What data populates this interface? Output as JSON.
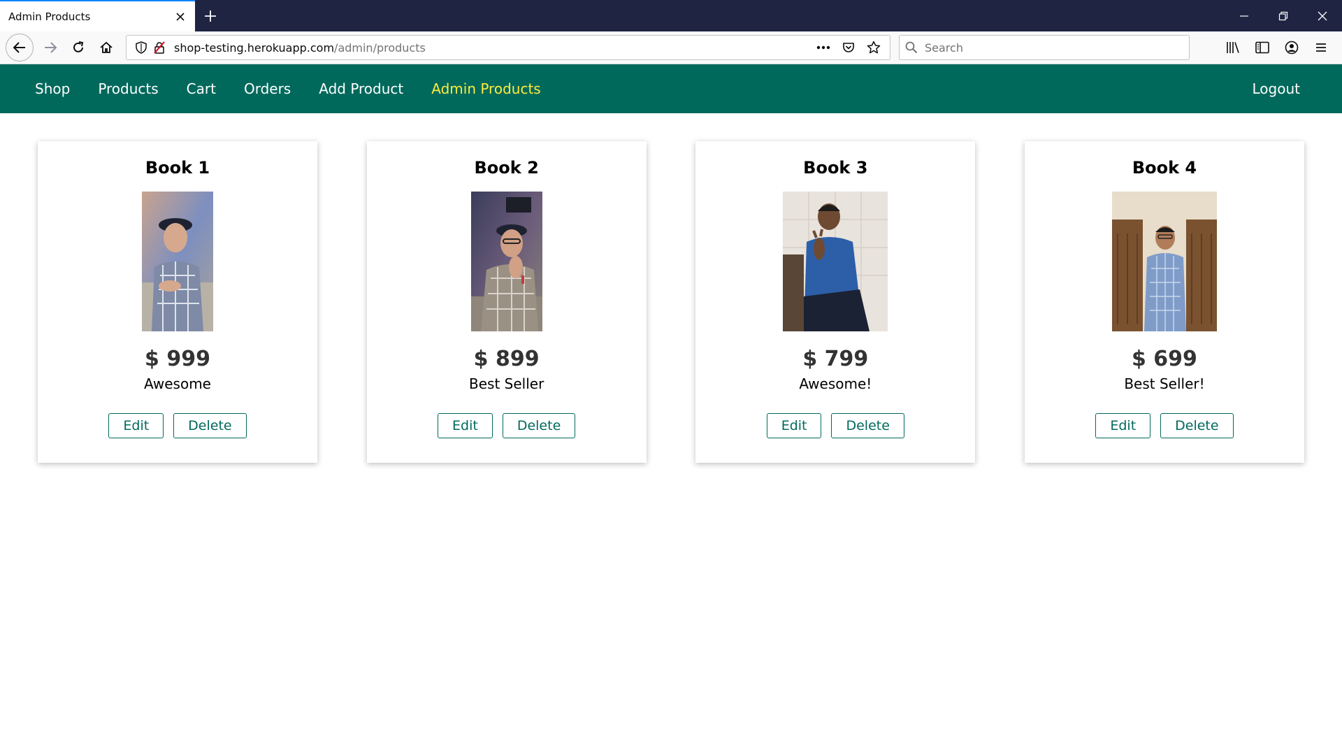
{
  "browser": {
    "tab_title": "Admin Products",
    "url_domain": "shop-testing.herokuapp.com",
    "url_path": "/admin/products",
    "search_placeholder": "Search"
  },
  "site": {
    "nav": [
      {
        "label": "Shop",
        "active": false
      },
      {
        "label": "Products",
        "active": false
      },
      {
        "label": "Cart",
        "active": false
      },
      {
        "label": "Orders",
        "active": false
      },
      {
        "label": "Add Product",
        "active": false
      },
      {
        "label": "Admin Products",
        "active": true
      }
    ],
    "logout_label": "Logout"
  },
  "products": [
    {
      "title": "Book 1",
      "price": "$ 999",
      "description": "Awesome",
      "edit_label": "Edit",
      "delete_label": "Delete"
    },
    {
      "title": "Book 2",
      "price": "$ 899",
      "description": "Best Seller",
      "edit_label": "Edit",
      "delete_label": "Delete"
    },
    {
      "title": "Book 3",
      "price": "$ 799",
      "description": "Awesome!",
      "edit_label": "Edit",
      "delete_label": "Delete"
    },
    {
      "title": "Book 4",
      "price": "$ 699",
      "description": "Best Seller!",
      "edit_label": "Edit",
      "delete_label": "Delete"
    }
  ],
  "colors": {
    "header_bg": "#00695c",
    "active_link": "#ffeb3b",
    "button_accent": "#00695c",
    "tabbar_bg": "#1f2442"
  }
}
